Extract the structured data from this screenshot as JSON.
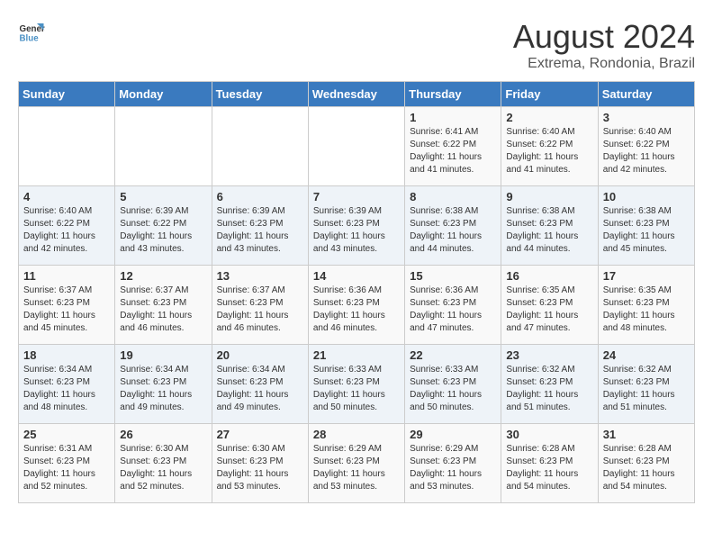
{
  "logo": {
    "line1": "General",
    "line2": "Blue"
  },
  "title": "August 2024",
  "subtitle": "Extrema, Rondonia, Brazil",
  "days_of_week": [
    "Sunday",
    "Monday",
    "Tuesday",
    "Wednesday",
    "Thursday",
    "Friday",
    "Saturday"
  ],
  "weeks": [
    [
      {
        "day": "",
        "info": ""
      },
      {
        "day": "",
        "info": ""
      },
      {
        "day": "",
        "info": ""
      },
      {
        "day": "",
        "info": ""
      },
      {
        "day": "1",
        "info": "Sunrise: 6:41 AM\nSunset: 6:22 PM\nDaylight: 11 hours\nand 41 minutes."
      },
      {
        "day": "2",
        "info": "Sunrise: 6:40 AM\nSunset: 6:22 PM\nDaylight: 11 hours\nand 41 minutes."
      },
      {
        "day": "3",
        "info": "Sunrise: 6:40 AM\nSunset: 6:22 PM\nDaylight: 11 hours\nand 42 minutes."
      }
    ],
    [
      {
        "day": "4",
        "info": "Sunrise: 6:40 AM\nSunset: 6:22 PM\nDaylight: 11 hours\nand 42 minutes."
      },
      {
        "day": "5",
        "info": "Sunrise: 6:39 AM\nSunset: 6:22 PM\nDaylight: 11 hours\nand 43 minutes."
      },
      {
        "day": "6",
        "info": "Sunrise: 6:39 AM\nSunset: 6:23 PM\nDaylight: 11 hours\nand 43 minutes."
      },
      {
        "day": "7",
        "info": "Sunrise: 6:39 AM\nSunset: 6:23 PM\nDaylight: 11 hours\nand 43 minutes."
      },
      {
        "day": "8",
        "info": "Sunrise: 6:38 AM\nSunset: 6:23 PM\nDaylight: 11 hours\nand 44 minutes."
      },
      {
        "day": "9",
        "info": "Sunrise: 6:38 AM\nSunset: 6:23 PM\nDaylight: 11 hours\nand 44 minutes."
      },
      {
        "day": "10",
        "info": "Sunrise: 6:38 AM\nSunset: 6:23 PM\nDaylight: 11 hours\nand 45 minutes."
      }
    ],
    [
      {
        "day": "11",
        "info": "Sunrise: 6:37 AM\nSunset: 6:23 PM\nDaylight: 11 hours\nand 45 minutes."
      },
      {
        "day": "12",
        "info": "Sunrise: 6:37 AM\nSunset: 6:23 PM\nDaylight: 11 hours\nand 46 minutes."
      },
      {
        "day": "13",
        "info": "Sunrise: 6:37 AM\nSunset: 6:23 PM\nDaylight: 11 hours\nand 46 minutes."
      },
      {
        "day": "14",
        "info": "Sunrise: 6:36 AM\nSunset: 6:23 PM\nDaylight: 11 hours\nand 46 minutes."
      },
      {
        "day": "15",
        "info": "Sunrise: 6:36 AM\nSunset: 6:23 PM\nDaylight: 11 hours\nand 47 minutes."
      },
      {
        "day": "16",
        "info": "Sunrise: 6:35 AM\nSunset: 6:23 PM\nDaylight: 11 hours\nand 47 minutes."
      },
      {
        "day": "17",
        "info": "Sunrise: 6:35 AM\nSunset: 6:23 PM\nDaylight: 11 hours\nand 48 minutes."
      }
    ],
    [
      {
        "day": "18",
        "info": "Sunrise: 6:34 AM\nSunset: 6:23 PM\nDaylight: 11 hours\nand 48 minutes."
      },
      {
        "day": "19",
        "info": "Sunrise: 6:34 AM\nSunset: 6:23 PM\nDaylight: 11 hours\nand 49 minutes."
      },
      {
        "day": "20",
        "info": "Sunrise: 6:34 AM\nSunset: 6:23 PM\nDaylight: 11 hours\nand 49 minutes."
      },
      {
        "day": "21",
        "info": "Sunrise: 6:33 AM\nSunset: 6:23 PM\nDaylight: 11 hours\nand 50 minutes."
      },
      {
        "day": "22",
        "info": "Sunrise: 6:33 AM\nSunset: 6:23 PM\nDaylight: 11 hours\nand 50 minutes."
      },
      {
        "day": "23",
        "info": "Sunrise: 6:32 AM\nSunset: 6:23 PM\nDaylight: 11 hours\nand 51 minutes."
      },
      {
        "day": "24",
        "info": "Sunrise: 6:32 AM\nSunset: 6:23 PM\nDaylight: 11 hours\nand 51 minutes."
      }
    ],
    [
      {
        "day": "25",
        "info": "Sunrise: 6:31 AM\nSunset: 6:23 PM\nDaylight: 11 hours\nand 52 minutes."
      },
      {
        "day": "26",
        "info": "Sunrise: 6:30 AM\nSunset: 6:23 PM\nDaylight: 11 hours\nand 52 minutes."
      },
      {
        "day": "27",
        "info": "Sunrise: 6:30 AM\nSunset: 6:23 PM\nDaylight: 11 hours\nand 53 minutes."
      },
      {
        "day": "28",
        "info": "Sunrise: 6:29 AM\nSunset: 6:23 PM\nDaylight: 11 hours\nand 53 minutes."
      },
      {
        "day": "29",
        "info": "Sunrise: 6:29 AM\nSunset: 6:23 PM\nDaylight: 11 hours\nand 53 minutes."
      },
      {
        "day": "30",
        "info": "Sunrise: 6:28 AM\nSunset: 6:23 PM\nDaylight: 11 hours\nand 54 minutes."
      },
      {
        "day": "31",
        "info": "Sunrise: 6:28 AM\nSunset: 6:23 PM\nDaylight: 11 hours\nand 54 minutes."
      }
    ]
  ]
}
